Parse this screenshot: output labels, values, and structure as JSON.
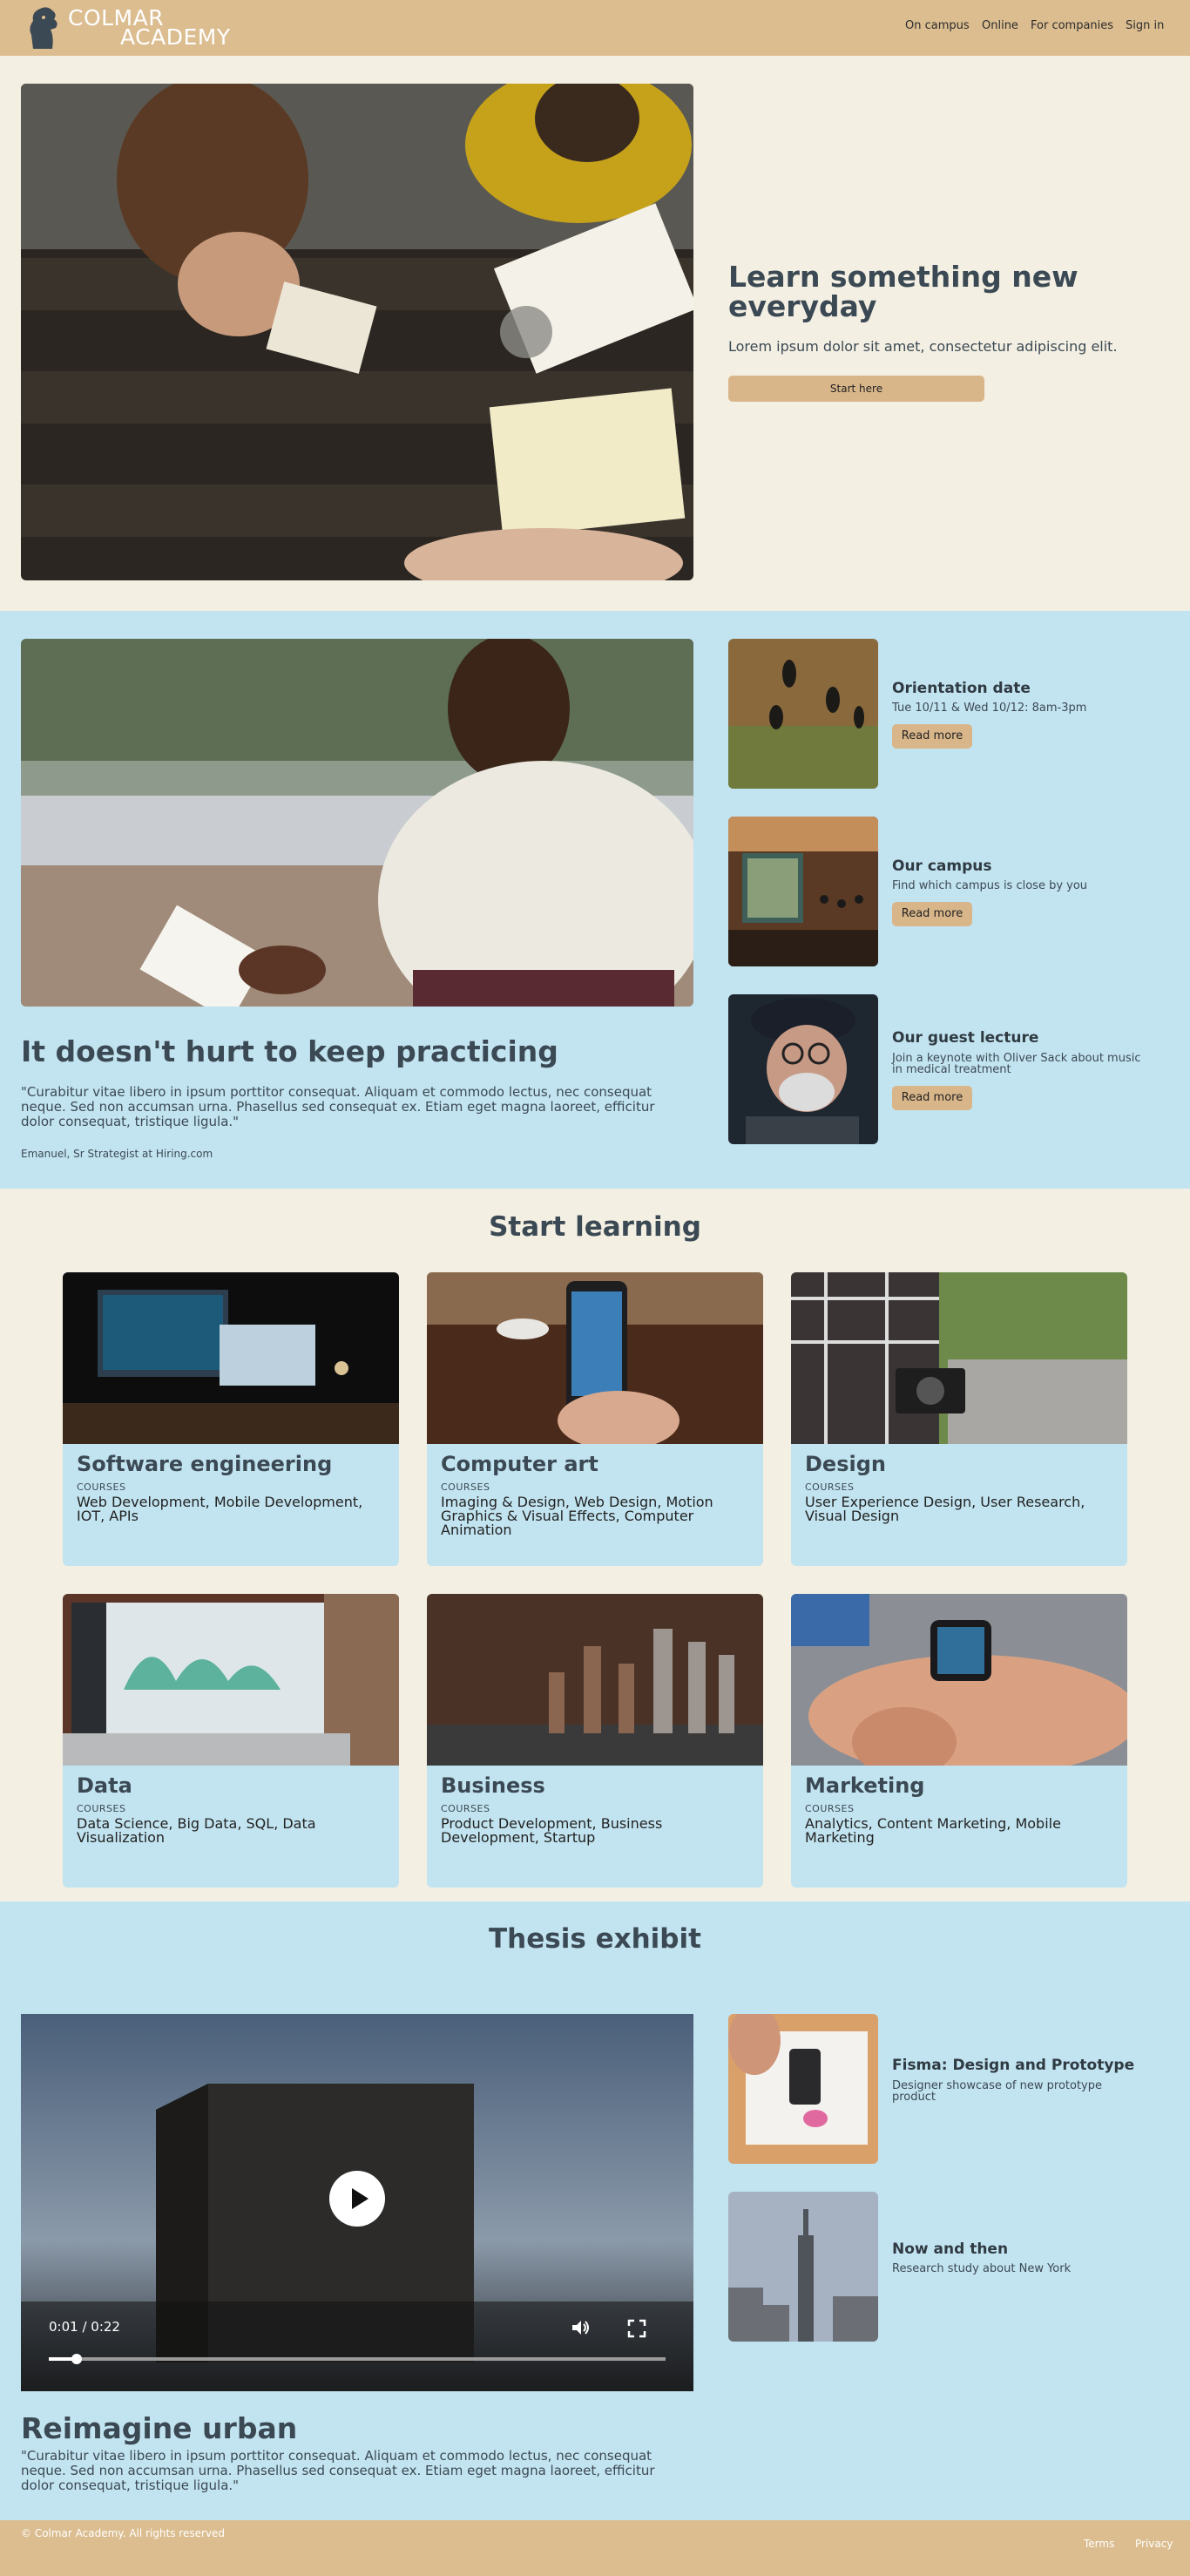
{
  "header": {
    "brand_line1": "COLMAR",
    "brand_line2": "ACADEMY",
    "nav": [
      "On campus",
      "Online",
      "For companies",
      "Sign in"
    ]
  },
  "hero": {
    "title": "Learn something new everyday",
    "subtitle": "Lorem ipsum dolor sit amet, consectetur adipiscing elit.",
    "button": "Start here"
  },
  "practice": {
    "title": "It doesn't hurt to keep practicing",
    "quote": "\"Curabitur vitae libero in ipsum porttitor consequat. Aliquam et commodo lectus, nec consequat neque. Sed non accumsan urna. Phasellus sed consequat ex. Etiam eget magna laoreet, efficitur dolor consequat, tristique ligula.\"",
    "author": "Emanuel, Sr Strategist at Hiring.com",
    "events": [
      {
        "title": "Orientation date",
        "sub": "Tue 10/11 & Wed 10/12: 8am-3pm",
        "button": "Read more"
      },
      {
        "title": "Our campus",
        "sub": "Find which campus is close by you",
        "button": "Read more"
      },
      {
        "title": "Our guest lecture",
        "sub": "Join a keynote with Oliver Sack about music in medical treatment",
        "button": "Read more"
      }
    ]
  },
  "learning": {
    "title": "Start learning",
    "courses": [
      {
        "title": "Software engineering",
        "label": "COURSES",
        "desc": "Web Development, Mobile Development, IOT, APIs"
      },
      {
        "title": "Computer art",
        "label": "COURSES",
        "desc": "Imaging & Design, Web Design, Motion Graphics & Visual Effects, Computer Animation"
      },
      {
        "title": "Design",
        "label": "COURSES",
        "desc": "User Experience Design, User Research, Visual Design"
      },
      {
        "title": "Data",
        "label": "COURSES",
        "desc": "Data Science, Big Data, SQL, Data Visualization"
      },
      {
        "title": "Business",
        "label": "COURSES",
        "desc": "Product Development, Business Development, Startup"
      },
      {
        "title": "Marketing",
        "label": "COURSES",
        "desc": "Analytics, Content Marketing, Mobile Marketing"
      }
    ]
  },
  "thesis": {
    "title": "Thesis exhibit",
    "video_time": "0:01 / 0:22",
    "video_progress": 0.045,
    "main_title": "Reimagine urban",
    "main_quote": "\"Curabitur vitae libero in ipsum porttitor consequat. Aliquam et commodo lectus, nec consequat neque. Sed non accumsan urna. Phasellus sed consequat ex. Etiam eget magna laoreet, efficitur dolor consequat, tristique ligula.\"",
    "projects": [
      {
        "title": "Fisma: Design and Prototype",
        "sub": "Designer showcase of new prototype product"
      },
      {
        "title": "Now and then",
        "sub": "Research study about New York"
      }
    ]
  },
  "footer": {
    "copyright": "© Colmar Academy. All rights reserved",
    "links": [
      "Terms",
      "Privacy"
    ]
  },
  "colors": {
    "header_bg": "#dbbd90",
    "cream_bg": "#f3efe2",
    "blue_bg": "#c2e4f0",
    "button": "#d9b68a",
    "heading": "#3b4954"
  }
}
